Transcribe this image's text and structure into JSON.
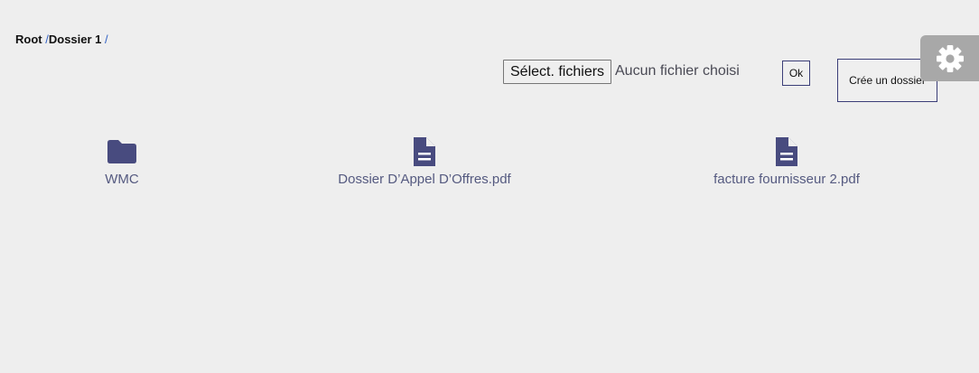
{
  "breadcrumb": {
    "root": "Root",
    "separator": "/",
    "current": "Dossier 1",
    "trailing_separator": "/"
  },
  "upload": {
    "select_button_label": "Sélect. fichiers",
    "no_file_text": "Aucun fichier choisi",
    "ok_button_label": "Ok"
  },
  "create_folder_button_label": "Crée un dossier",
  "settings": {
    "icon": "gear-icon"
  },
  "items": [
    {
      "type": "folder",
      "icon": "folder-icon",
      "name": "WMC"
    },
    {
      "type": "file",
      "icon": "document-icon",
      "name": "Dossier D’Appel D’Offres.pdf"
    },
    {
      "type": "file",
      "icon": "document-icon",
      "name": "facture fournisseur 2.pdf"
    }
  ],
  "colors": {
    "background": "#eeeeee",
    "icon": "#484b7f",
    "label": "#555a80",
    "separator": "#2f5fc4",
    "settings_tab": "#a8a8a8"
  }
}
